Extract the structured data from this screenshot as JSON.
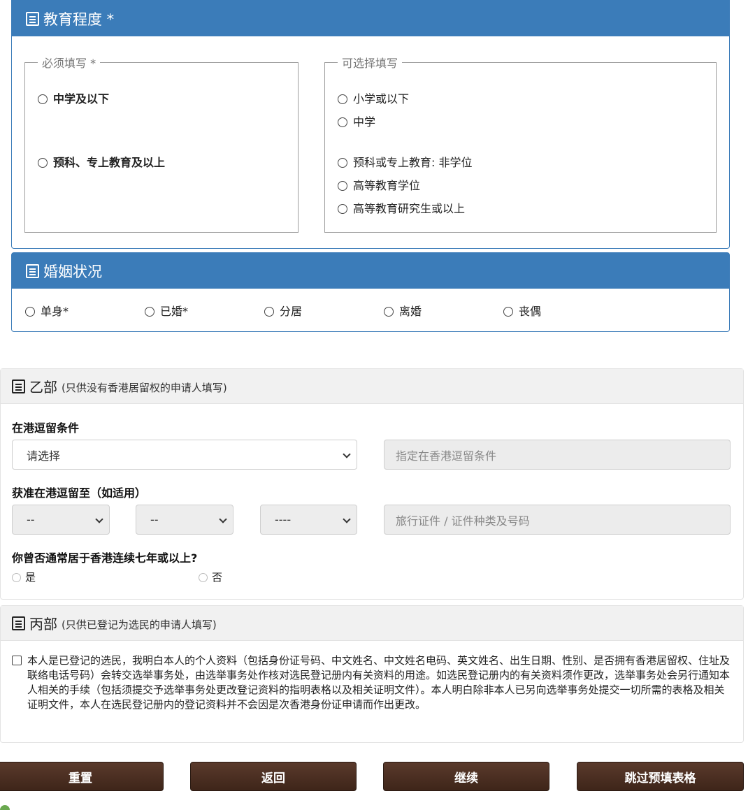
{
  "education": {
    "title": "教育程度 *",
    "required_legend": "必须填写 *",
    "optional_legend": "可选择填写",
    "required_options": [
      "中学及以下",
      "预科、专上教育及以上"
    ],
    "optional_options": [
      "小学或以下",
      "中学",
      "预科或专上教育: 非学位",
      "高等教育学位",
      "高等教育研究生或以上"
    ]
  },
  "marital": {
    "title": "婚姻状况",
    "options": [
      "单身*",
      "已婚*",
      "分居",
      "离婚",
      "丧偶"
    ]
  },
  "partB": {
    "title": "乙部",
    "subtitle": "(只供没有香港居留权的申请人填写)",
    "stay_condition_label": "在港逗留条件",
    "stay_condition_select": "请选择",
    "stay_condition_placeholder": "指定在香港逗留条件",
    "permitted_until_label": "获准在港逗留至（如适用）",
    "day_select": "--",
    "month_select": "--",
    "year_select": "----",
    "travel_doc_placeholder": "旅行证件 / 证件种类及号码",
    "seven_years_label": "你曾否通常居于香港连续七年或以上?",
    "yes": "是",
    "no": "否"
  },
  "partC": {
    "title": "丙部",
    "subtitle": "(只供已登记为选民的申请人填写)",
    "declaration": "本人是已登记的选民，我明白本人的个人资料（包括身份证号码、中文姓名、中文姓名电码、英文姓名、出生日期、性别、是否拥有香港居留权、住址及联络电话号码）会转交选举事务处，由选举事务处作核对选民登记册内有关资料的用途。如选民登记册内的有关资料须作更改，选举事务处会另行通知本人相关的手续（包括须提交予选举事务处更改登记资料的指明表格以及相关证明文件）。本人明白除非本人已另向选举事务处提交一切所需的表格及相关证明文件，本人在选民登记册内的登记资料并不会因是次香港身份证申请而作出更改。"
  },
  "buttons": {
    "reset": "重置",
    "back": "返回",
    "continue": "继续",
    "skip": "跳过预填表格"
  },
  "colors": {
    "panel_blue": "#3b7cb9",
    "button_brown": "#4a2e22"
  }
}
